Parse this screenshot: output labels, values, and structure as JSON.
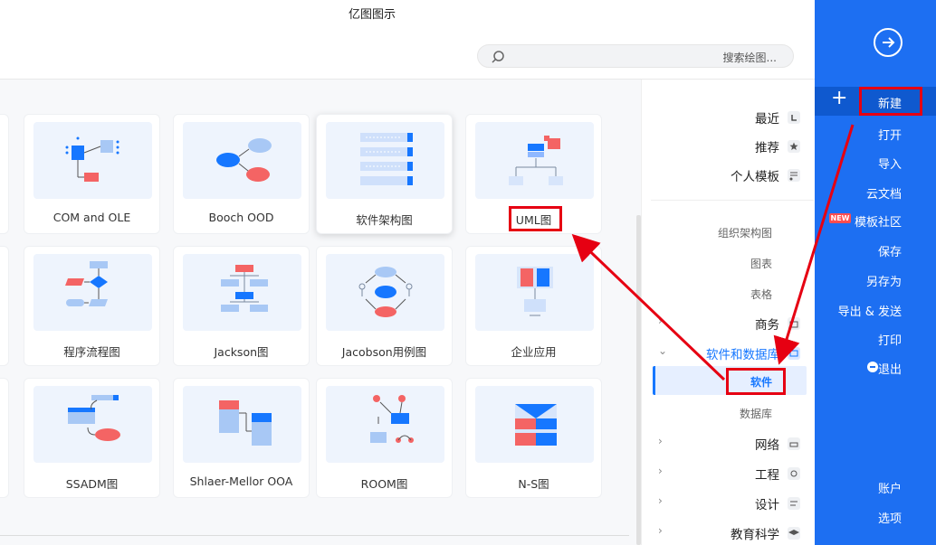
{
  "app": {
    "title": "亿图图示"
  },
  "search": {
    "placeholder": "搜索绘图..."
  },
  "gallery": {
    "row1": [
      "UML图",
      "软件架构图",
      "Booch OOD",
      "COM and OLE"
    ],
    "row2": [
      "企业应用",
      "Jacobson用例图",
      "Jackson图",
      "程序流程图"
    ],
    "row3": [
      "N-S图",
      "ROOM图",
      "Shlaer-Mellor OOA",
      "SSADM图"
    ]
  },
  "catnav": {
    "top": [
      {
        "label": "最近",
        "icon": "clock-icon"
      },
      {
        "label": "推荐",
        "icon": "star-icon"
      },
      {
        "label": "个人模板",
        "icon": "personal-template-icon"
      }
    ],
    "subs_top": [
      "组织架构图",
      "图表",
      "表格"
    ],
    "business": "商务",
    "software_db": "软件和数据库",
    "software": "软件",
    "database": "数据库",
    "rest": [
      "网络",
      "工程",
      "设计",
      "教育科学"
    ]
  },
  "sidebar": {
    "new": "新建",
    "open": "打开",
    "import": "导入",
    "cloud": "云文档",
    "community": "模板社区",
    "new_badge": "NEW",
    "save": "保存",
    "save_as": "另存为",
    "export": "导出 & 发送",
    "print": "打印",
    "exit": "退出",
    "account": "账户",
    "options": "选项"
  },
  "colors": {
    "sidebar": "#1d6ff2",
    "accent": "#1677ff",
    "annotation": "#e60012"
  }
}
